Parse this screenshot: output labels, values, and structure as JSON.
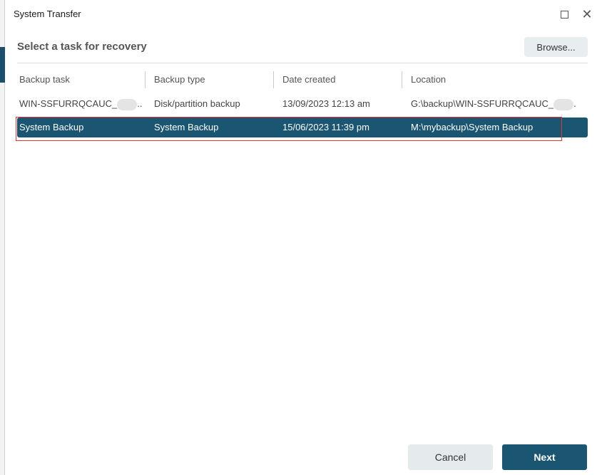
{
  "window": {
    "title": "System Transfer"
  },
  "heading": "Select a task for recovery",
  "browse_label": "Browse...",
  "columns": [
    "Backup task",
    "Backup type",
    "Date created",
    "Location"
  ],
  "rows": [
    {
      "task": "WIN-SSFURRQCAUC_",
      "task_suffix": "..",
      "type": "Disk/partition backup",
      "date": "13/09/2023 12:13 am",
      "location": "G:\\backup\\WIN-SSFURRQCAUC_",
      "location_suffix": ".",
      "selected": false
    },
    {
      "task": "System Backup",
      "type": "System Backup",
      "date": "15/06/2023 11:39 pm",
      "location": "M:\\mybackup\\System Backup",
      "selected": true
    }
  ],
  "buttons": {
    "cancel": "Cancel",
    "next": "Next"
  },
  "colors": {
    "accent": "#1a5572",
    "highlight_border": "#e53935"
  }
}
